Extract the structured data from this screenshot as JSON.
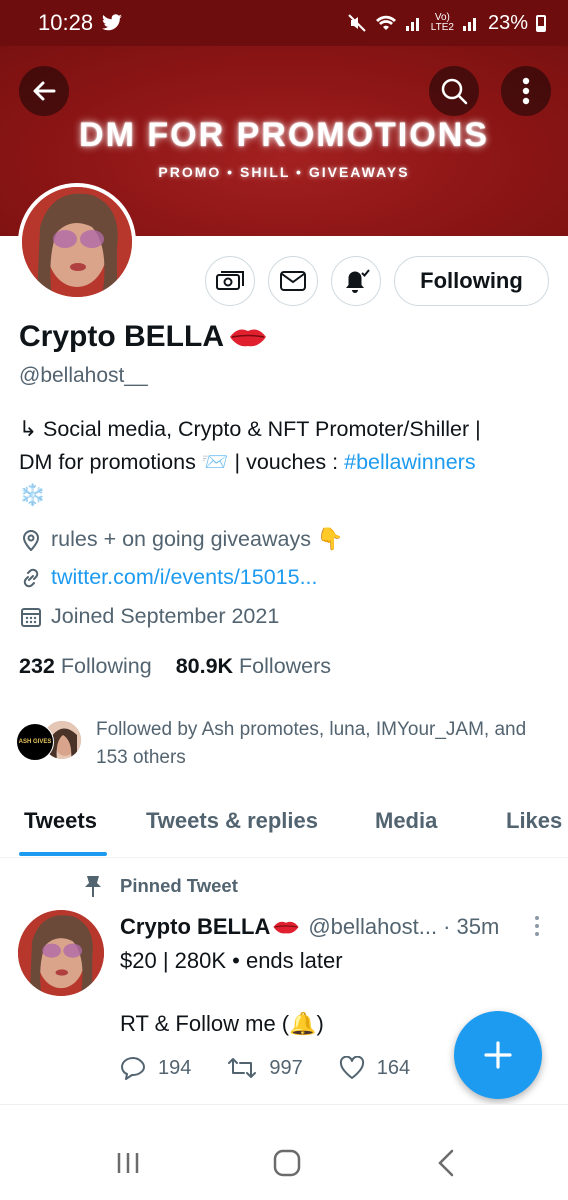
{
  "status_bar": {
    "time": "10:28",
    "network": "LTE2",
    "volte": "Vo)",
    "battery": "23%"
  },
  "banner": {
    "title": "DM FOR PROMOTIONS",
    "subtitle": "PROMO • SHILL • GIVEAWAYS"
  },
  "profile": {
    "name": "Crypto BELLA",
    "handle": "@bellahost__",
    "bio_line1": "↳ Social media, Crypto & NFT Promoter/Shiller |",
    "bio_line2_prefix": "DM for promotions 📨 | vouches : ",
    "bio_hashtag": "#bellawinners",
    "bio_line3": "❄️",
    "location": "rules + on going giveaways 👇",
    "link": "twitter.com/i/events/15015...",
    "joined": "Joined September 2021",
    "following_count": "232",
    "following_label": "Following",
    "followers_count": "80.9K",
    "followers_label": "Followers",
    "followed_by": "Followed by Ash promotes, luna, IMYour_JAM, and 153 others",
    "follower_avatar_text": "ASH GIVES"
  },
  "actions": {
    "following_button": "Following"
  },
  "tabs": [
    "Tweets",
    "Tweets & replies",
    "Media",
    "Likes"
  ],
  "pinned_label": "Pinned Tweet",
  "tweet": {
    "name": "Crypto BELLA",
    "handle": "@bellahost...",
    "time": "· 35m",
    "line1": "$20 | 280K • ends later",
    "line2": "RT & Follow me (🔔)",
    "replies": "194",
    "retweets": "997",
    "likes": "164"
  },
  "colors": {
    "accent": "#1d9bf0",
    "banner": "#8c1515",
    "statusbar": "#6e0d0d"
  }
}
